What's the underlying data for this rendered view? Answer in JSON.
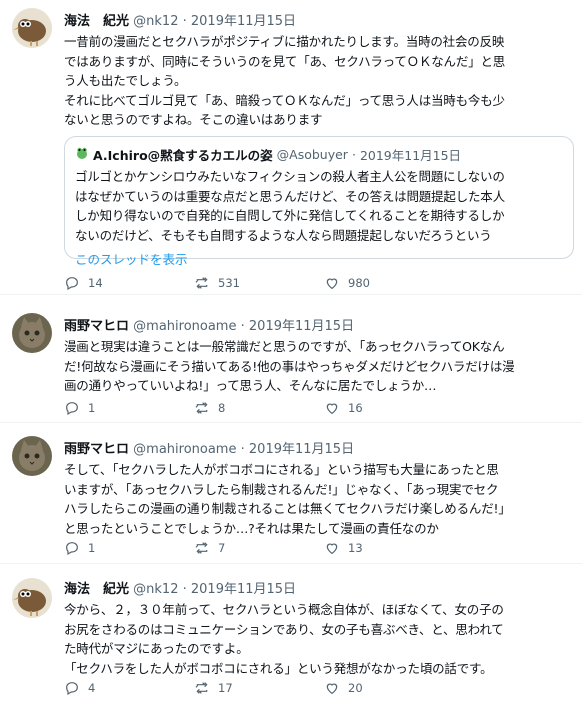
{
  "tweets": [
    {
      "name": "海法　紀光",
      "handle": "@nk12",
      "date": "2019年11月15日",
      "avatar": "kiwi-bird-avatar",
      "body": "一昔前の漫画だとセクハラがポジティブに描かれたりします。当時の社会の反映\nではありますが、同時にそういうのを見て「あ、セクハラってＯＫなんだ」と思\nう人も出たでしょう。\nそれに比べてゴルゴ見て「あ、暗殺ってＯＫなんだ」って思う人は当時も今も少\nないと思うのですよね。そこの違いはあります",
      "quote": {
        "name": "A.Ichiro@黙食するカエルの姿",
        "handle": "@Asobuyer",
        "date": "2019年11月15日",
        "body": "ゴルゴとかケンシロウみたいなフィクションの殺人者主人公を問題にしないの\nはなぜかていうのは重要な点だと思うんだけど、その答えは問題提起した本人\nしか知り得ないので自発的に自問して外に発信してくれることを期待するしか\nないのだけど、そもそも自問するような人なら問題提起しないだろうという",
        "link": "このスレッドを表示"
      },
      "replies": "14",
      "retweets": "531",
      "likes": "980"
    },
    {
      "name": "雨野マヒロ",
      "handle": "@mahironoame",
      "date": "2019年11月15日",
      "avatar": "cat-avatar",
      "body": "漫画と現実は違うことは一般常識だと思うのですが、「あっセクハラってOKなん\nだ!何故なら漫画にそう描いてある!他の事はやっちゃダメだけどセクハラだけは漫\n画の通りやっていいよね!」って思う人、そんなに居たでしょうか…",
      "replies": "1",
      "retweets": "8",
      "likes": "16"
    },
    {
      "name": "雨野マヒロ",
      "handle": "@mahironoame",
      "date": "2019年11月15日",
      "avatar": "cat-avatar",
      "body": "そして、「セクハラした人がボコボコにされる」という描写も大量にあったと思\nいますが、「あっセクハラしたら制裁されるんだ!」じゃなく、「あっ現実でセク\nハラしたらこの漫画の通り制裁されることは無くてセクハラだけ楽しめるんだ!」\nと思ったということでしょうか…?それは果たして漫画の責任なのか",
      "replies": "1",
      "retweets": "7",
      "likes": "13"
    },
    {
      "name": "海法　紀光",
      "handle": "@nk12",
      "date": "2019年11月15日",
      "avatar": "kiwi-bird-avatar",
      "body": "今から、２，３０年前って、セクハラという概念自体が、ほぼなくて、女の子の\nお尻をさわるのはコミュニケーションであり、女の子も喜ぶべき、と、思われて\nた時代がマジにあったのですよ。\n「セクハラをした人がボコボコにされる」という発想がなかった頃の話です。",
      "replies": "4",
      "retweets": "17",
      "likes": "20"
    }
  ],
  "colors": {
    "text": "#0f1419",
    "muted": "#536471",
    "link": "#1d9bf0",
    "border": "#cfd9de",
    "frog": "#5cb85c"
  }
}
